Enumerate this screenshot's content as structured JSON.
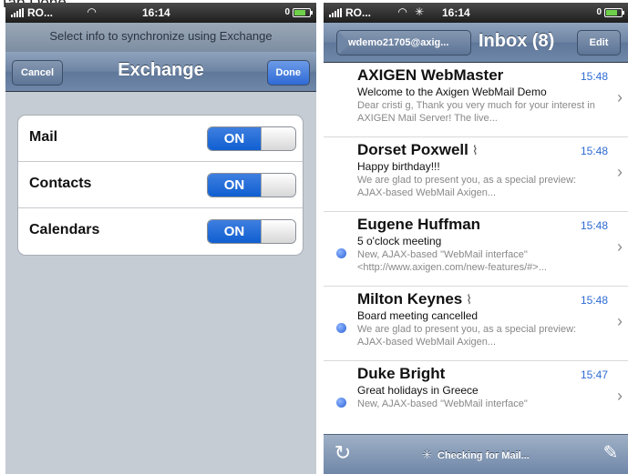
{
  "caption": "Tap Done.",
  "left_phone": {
    "status": {
      "carrier": "RO...",
      "time": "16:14",
      "battery": "0"
    },
    "prompt": "Select info to synchronize using Exchange",
    "nav": {
      "cancel": "Cancel",
      "title": "Exchange",
      "done": "Done"
    },
    "settings": [
      {
        "label": "Mail",
        "toggle": "ON"
      },
      {
        "label": "Contacts",
        "toggle": "ON"
      },
      {
        "label": "Calendars",
        "toggle": "ON"
      }
    ]
  },
  "right_phone": {
    "status": {
      "carrier": "RO...",
      "time": "16:14",
      "battery": "0"
    },
    "nav": {
      "back": "wdemo21705@axig...",
      "title": "Inbox (8)",
      "edit": "Edit"
    },
    "messages": [
      {
        "from": "AXIGEN WebMaster",
        "time": "15:48",
        "subject": "Welcome to the Axigen WebMail Demo",
        "preview": "Dear cristi g, Thank you very much for your interest in AXIGEN Mail Server! The live...",
        "unread": false,
        "attachment": false
      },
      {
        "from": "Dorset Poxwell",
        "time": "15:48",
        "subject": "Happy birthday!!!",
        "preview": "We are glad to present you, as a special preview: AJAX-based WebMail Axigen...",
        "unread": false,
        "attachment": true
      },
      {
        "from": "Eugene Huffman",
        "time": "15:48",
        "subject": "5 o'clock meeting",
        "preview": "New, AJAX-based \"WebMail interface\" <http://www.axigen.com/new-features/#>...",
        "unread": true,
        "attachment": false
      },
      {
        "from": "Milton Keynes",
        "time": "15:48",
        "subject": "Board meeting cancelled",
        "preview": "We are glad to present you, as a special preview: AJAX-based WebMail Axigen...",
        "unread": true,
        "attachment": true
      },
      {
        "from": "Duke Bright",
        "time": "15:47",
        "subject": "Great holidays in Greece",
        "preview": "New, AJAX-based \"WebMail interface\"",
        "unread": true,
        "attachment": false
      }
    ],
    "toolbar": {
      "status": "Checking for Mail..."
    }
  },
  "colors": {
    "toggle_on": "#0f5fd1",
    "nav_bar": "#6d84a3",
    "time_text": "#2d6bd3",
    "unread_dot": "#2b63d6"
  },
  "icons": [
    "wifi-icon",
    "battery-icon",
    "refresh-icon",
    "spinner-icon",
    "compose-icon",
    "chevron-right-icon",
    "paperclip-icon"
  ]
}
